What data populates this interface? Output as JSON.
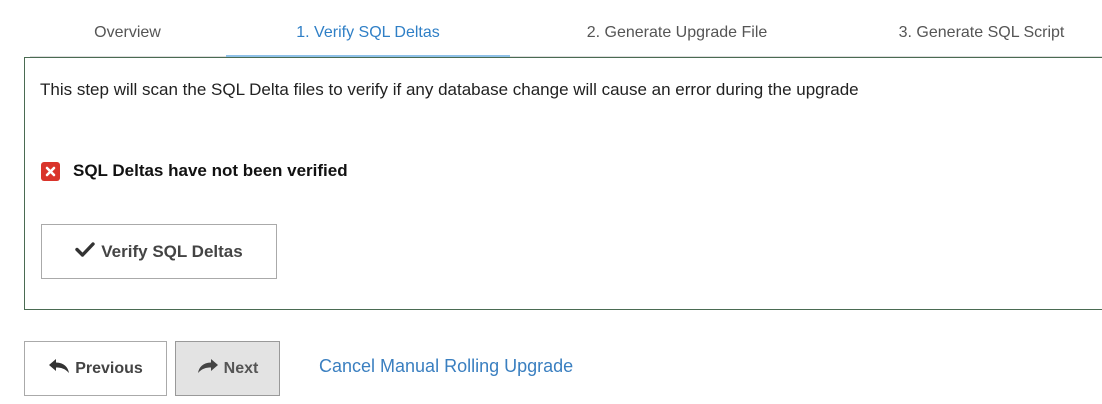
{
  "tabs": [
    {
      "label": "Overview",
      "active": false
    },
    {
      "label": "1. Verify SQL Deltas",
      "active": true
    },
    {
      "label": "2. Generate Upgrade File",
      "active": false
    },
    {
      "label": "3. Generate SQL Script",
      "active": false
    }
  ],
  "panel": {
    "description": "This step will scan the SQL Delta files to verify if any database change will cause an error during the upgrade",
    "status_text": "SQL Deltas have not been verified",
    "status_icon": "error-x-icon",
    "verify_button_label": "Verify SQL Deltas",
    "verify_button_icon": "checkmark-icon"
  },
  "footer": {
    "previous_label": "Previous",
    "previous_icon": "reply-arrow-icon",
    "next_label": "Next",
    "next_icon": "share-arrow-icon",
    "cancel_link_label": "Cancel Manual Rolling Upgrade"
  },
  "colors": {
    "active_tab": "#2f7fc6",
    "active_tab_underline": "#8fc1e8",
    "panel_border": "#4a6b52",
    "error_icon": "#d9342b",
    "link": "#3a7fc0"
  }
}
